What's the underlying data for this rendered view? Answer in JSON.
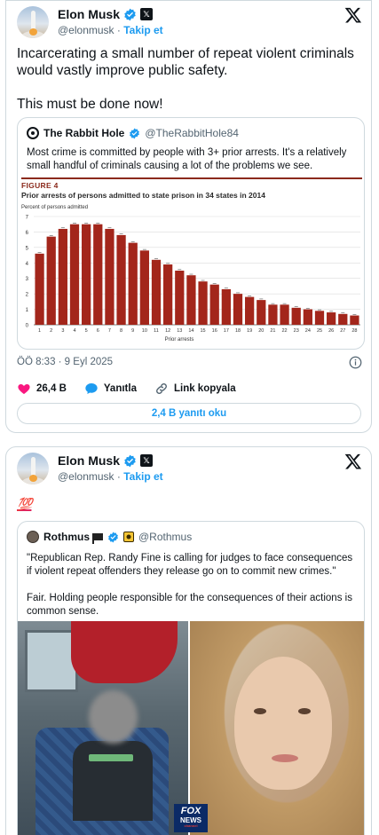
{
  "post1": {
    "author": {
      "name": "Elon Musk",
      "handle": "@elonmusk",
      "follow": "Takip et"
    },
    "text": "Incarcerating a small number of repeat violent criminals would vastly improve public safety.\n\nThis must be done now!",
    "quote": {
      "name": "The Rabbit Hole",
      "handle": "@TheRabbitHole84",
      "text": "Most crime is committed by people with 3+ prior arrests. It's a relatively small handful of criminals causing a lot of the problems we see.",
      "figure_label": "FIGURE 4",
      "figure_title": "Prior arrests of persons admitted to state prison in 34 states in 2014",
      "chart_data": {
        "type": "bar",
        "title": "Prior arrests of persons admitted to state prison in 34 states in 2014",
        "ylabel": "Percent of persons admitted",
        "xlabel": "Prior arrests",
        "ylim": [
          0,
          7
        ],
        "yticks": [
          0,
          1,
          2,
          3,
          4,
          5,
          6,
          7
        ],
        "categories": [
          "1",
          "2",
          "3",
          "4",
          "5",
          "6",
          "7",
          "8",
          "9",
          "10",
          "11",
          "12",
          "13",
          "14",
          "15",
          "16",
          "17",
          "18",
          "19",
          "20",
          "21",
          "22",
          "23",
          "24",
          "25",
          "26",
          "27",
          "28"
        ],
        "values": [
          4.6,
          5.7,
          6.2,
          6.5,
          6.5,
          6.5,
          6.2,
          5.8,
          5.3,
          4.8,
          4.2,
          3.9,
          3.5,
          3.2,
          2.8,
          2.6,
          2.3,
          2.0,
          1.8,
          1.6,
          1.3,
          1.3,
          1.1,
          1.0,
          0.9,
          0.8,
          0.7,
          0.6
        ],
        "bar_color": "#a3261b",
        "grid": true
      }
    },
    "timestamp": "ÖÖ 8:33 · 9 Eyl 2025",
    "likes": "26,4 B",
    "reply_label": "Yanıtla",
    "copy_link_label": "Link kopyala",
    "read_replies": "2,4 B yanıtı oku"
  },
  "post2": {
    "author": {
      "name": "Elon Musk",
      "handle": "@elonmusk",
      "follow": "Takip et"
    },
    "emoji": "💯",
    "quote": {
      "name": "Rothmus",
      "handle": "@Rothmus",
      "text": "\"Republican Rep. Randy Fine is calling for judges to face consequences if violent repeat offenders they release go on to commit new crimes.\"\n\nFair. Holding people responsible for the consequences of their actions is common sense.",
      "fox_logo": "FOX NEWS channel"
    }
  },
  "colors": {
    "accent": "#1d9bf0",
    "like": "#f91880",
    "bar": "#a3261b"
  }
}
